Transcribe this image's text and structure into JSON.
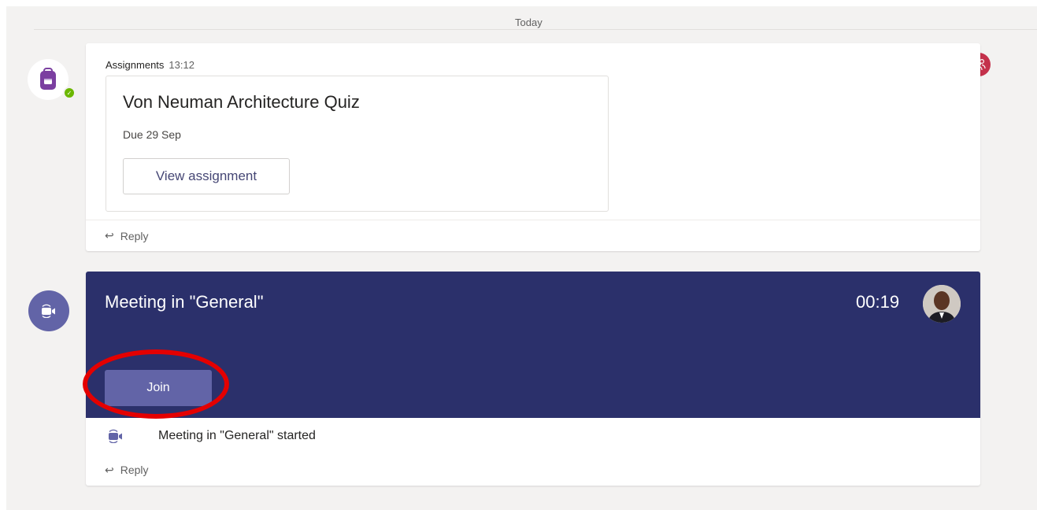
{
  "divider": {
    "label": "Today"
  },
  "assignment_post": {
    "sender": "Assignments",
    "time": "13:12",
    "card": {
      "title": "Von Neuman Architecture Quiz",
      "due": "Due 29 Sep",
      "view_button": "View assignment"
    },
    "reply_label": "Reply"
  },
  "meeting_post": {
    "title": "Meeting in \"General\"",
    "timer": "00:19",
    "join_label": "Join",
    "started_text": "Meeting in \"General\" started",
    "reply_label": "Reply"
  },
  "colors": {
    "meeting_banner": "#2b306b",
    "join_button": "#6264a7",
    "team_badge": "#c4314b",
    "highlight": "#e40000"
  },
  "icons": [
    "backpack-icon",
    "presence-available-icon",
    "video-camera-icon",
    "team-icon",
    "reply-arrow-icon"
  ]
}
